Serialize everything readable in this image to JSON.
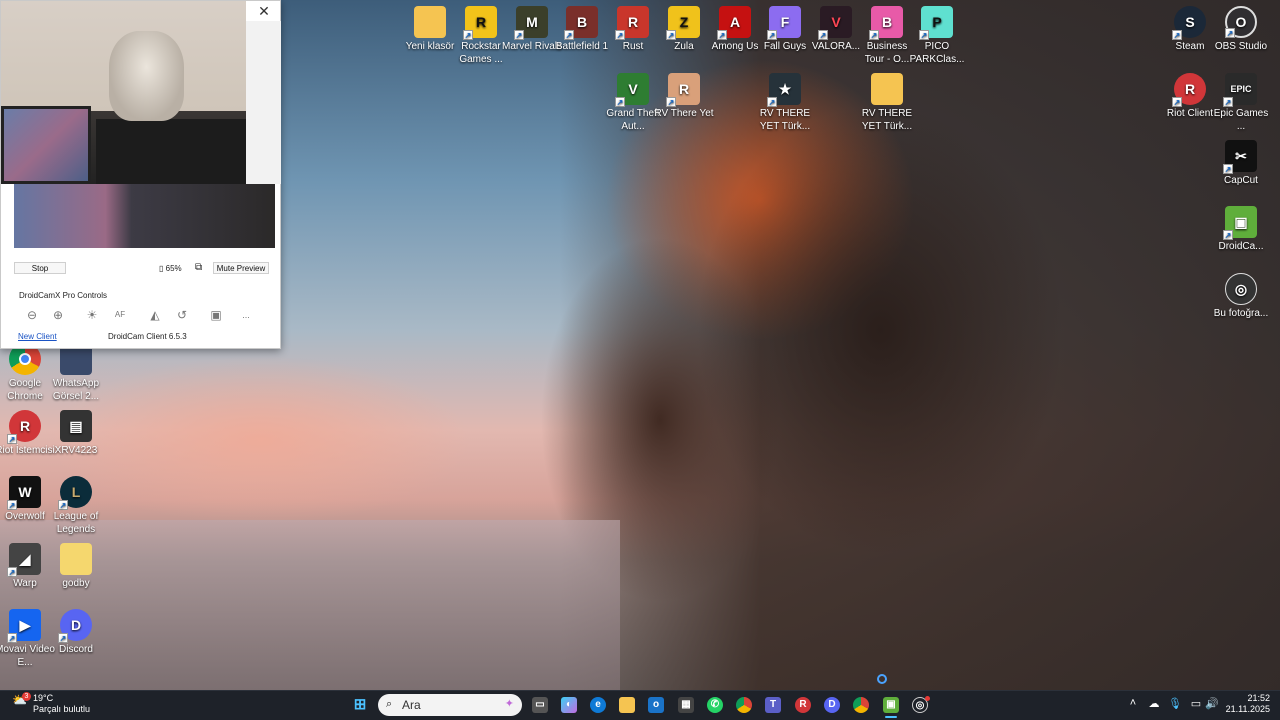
{
  "desktop_icons": {
    "yeni_klasor": "Yeni klasör",
    "rockstar": "Rockstar Games ...",
    "marvel": "Marvel Rivals",
    "battlefield": "Battlefield 1",
    "rust": "Rust",
    "zula": "Zula",
    "among_us": "Among Us",
    "fall_guys": "Fall Guys",
    "valorant": "VALORA...",
    "business_tour": "Business Tour - O...",
    "pico": "PICO PARKClas...",
    "steam": "Steam",
    "obs": "OBS Studio",
    "gta": "Grand Theft Aut...",
    "rv_there_yet": "RV There Yet",
    "rv_turk_1": "RV THERE YET Türk...",
    "rv_turk_2": "RV THERE YET Türk...",
    "riot_client": "Riot Client",
    "epic": "Epic Games ...",
    "capcut": "CapCut",
    "droidcam": "DroidCa...",
    "bu_fotograf": "Bu fotoğra...",
    "chrome": "Google Chrome",
    "whatsapp": "WhatsApp Görsel 2...",
    "riot_istemcisi": "Riot İstemcisi",
    "xrv": "XRV4223",
    "overwolf": "Overwolf",
    "league": "League of Legends",
    "warp": "Warp",
    "godby": "godby",
    "movavi": "Movavi Video E...",
    "discord": "Discord"
  },
  "droidcam": {
    "stop_label": "Stop",
    "battery": "65%",
    "mute_label": "Mute Preview",
    "controls_title": "DroidCamX Pro Controls",
    "af_label": "AF",
    "more_label": "...",
    "new_client_label": "New Client",
    "version_label": "DroidCam Client 6.5.3",
    "close_glyph": "✕"
  },
  "taskbar": {
    "search_placeholder": "Ara",
    "weather_temp": "19°C",
    "weather_desc": "Parçalı bulutlu",
    "weather_badge": "3",
    "time": "21:52",
    "date": "21.11.2025"
  }
}
